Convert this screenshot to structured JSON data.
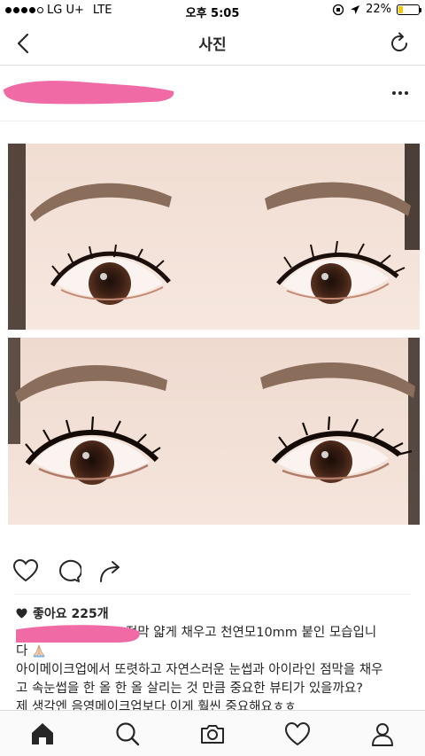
{
  "status_bar": {
    "carrier": "LG U+",
    "network": "LTE",
    "time": "오후 5:05",
    "battery_percent": "22%",
    "battery_level": 0.22,
    "signal_dots_filled": 4,
    "signal_dots_total": 5
  },
  "nav": {
    "title": "사진",
    "back_icon": "back-chevron-icon",
    "refresh_icon": "refresh-icon"
  },
  "post": {
    "more_icon": "more-dots-icon",
    "actions": {
      "like_icon": "heart-outline-icon",
      "comment_icon": "comment-bubble-icon",
      "share_icon": "share-arrow-icon"
    },
    "likes_text": "좋아요 225개",
    "caption": {
      "line1": "점막 얇게 채우고 천연모10mm 붙인 모습입니",
      "line2": "다",
      "line3": "아이메이크업에서 또렷하고 자연스러운 눈썹과 아이라인 점막을 채우",
      "line4": "고 속눈썹을 한 올 한 올 살리는 것 만큼 중요한 뷰티가 있을까요?",
      "line5": "제 생각엔 음영메이크업보다 이게 훨씬 중요해요ㅎㅎ"
    }
  },
  "tab_bar": {
    "items": [
      "home-icon",
      "search-icon",
      "camera-icon",
      "activity-heart-icon",
      "profile-icon"
    ],
    "active": "home-icon"
  },
  "colors": {
    "redaction": "#f06aa6",
    "battery": "#f6c700",
    "text": "#262626",
    "skin": "#f4e2d8"
  }
}
